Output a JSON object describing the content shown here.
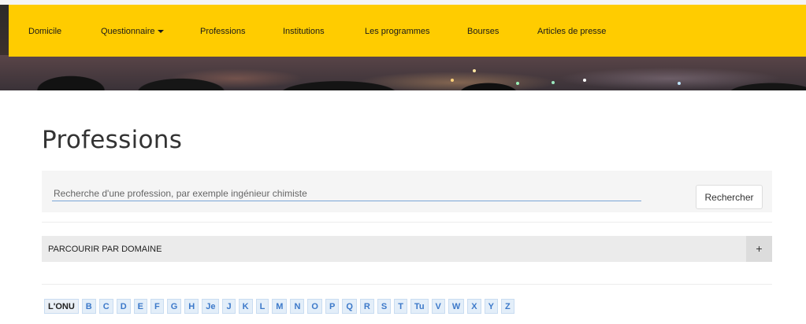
{
  "nav": {
    "items": [
      {
        "label": "Domicile"
      },
      {
        "label": "Questionnaire"
      },
      {
        "label": "Professions"
      },
      {
        "label": "Institutions"
      },
      {
        "label": "Les programmes"
      },
      {
        "label": "Bourses"
      },
      {
        "label": "Articles de presse"
      }
    ]
  },
  "page": {
    "title": "Professions"
  },
  "search": {
    "placeholder": "Recherche d'une profession, par exemple ingénieur chimiste",
    "value": "",
    "button_label": "Rechercher"
  },
  "browse": {
    "label": "PARCOURIR PAR DOMAINE",
    "toggle": "+"
  },
  "alphabet": {
    "items": [
      "L'ONU",
      "B",
      "C",
      "D",
      "E",
      "F",
      "G",
      "H",
      "Je",
      "J",
      "K",
      "L",
      "M",
      "N",
      "O",
      "P",
      "Q",
      "R",
      "S",
      "T",
      "Tu",
      "V",
      "W",
      "X",
      "Y",
      "Z"
    ]
  },
  "colors": {
    "nav_bg": "#ffcc00",
    "link": "#3d79c9",
    "chip_bg": "#e3eef9"
  }
}
